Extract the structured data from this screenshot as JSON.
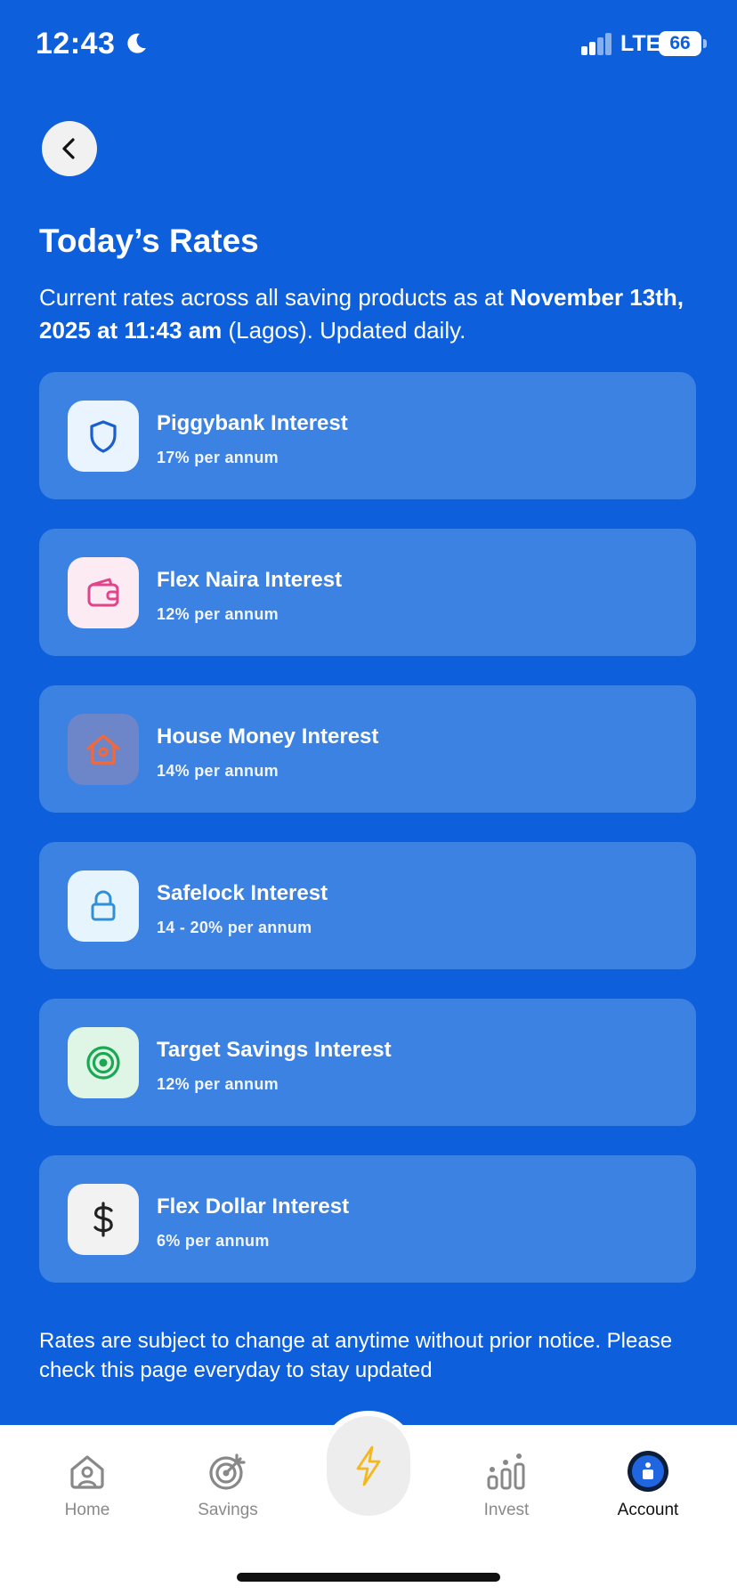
{
  "status_bar": {
    "time": "12:43",
    "network": "LTE",
    "battery": "66"
  },
  "header": {
    "title": "Today’s Rates",
    "subtitle_prefix": "Current rates across all saving products as at ",
    "subtitle_date": "November 13th, 2025 at 11:43 am",
    "subtitle_suffix": " (Lagos). Updated daily."
  },
  "rates": [
    {
      "name": "Piggybank Interest",
      "value": "17% per annum",
      "icon": "shield-icon",
      "icon_bg": "#eaf4ff",
      "icon_color": "#1a5fd0"
    },
    {
      "name": "Flex Naira Interest",
      "value": "12% per annum",
      "icon": "wallet-icon",
      "icon_bg": "#fdebf4",
      "icon_color": "#e0448a"
    },
    {
      "name": "House Money Interest",
      "value": "14% per annum",
      "icon": "house-icon",
      "icon_bg": "#6c86c9",
      "icon_color": "#f2683a"
    },
    {
      "name": "Safelock Interest",
      "value": "14 - 20% per annum",
      "icon": "lock-icon",
      "icon_bg": "#e6f4fd",
      "icon_color": "#2f8fd8"
    },
    {
      "name": "Target Savings Interest",
      "value": "12% per annum",
      "icon": "target-icon",
      "icon_bg": "#dff5e6",
      "icon_color": "#1aa853"
    },
    {
      "name": "Flex Dollar Interest",
      "value": "6% per annum",
      "icon": "dollar-icon",
      "icon_bg": "#f2f2f2",
      "icon_color": "#222222"
    }
  ],
  "footnote": "Rates are subject to change at anytime without prior notice. Please check this page everyday to stay updated",
  "tab_bar": {
    "tabs": [
      {
        "label": "Home",
        "icon": "home-icon"
      },
      {
        "label": "Savings",
        "icon": "savings-target-icon"
      },
      {
        "label": "",
        "icon": "lightning-icon"
      },
      {
        "label": "Invest",
        "icon": "invest-chart-icon"
      },
      {
        "label": "Account",
        "icon": "account-icon"
      }
    ],
    "active": "Account"
  },
  "colors": {
    "background": "#0d5fdc",
    "card": "#3c82e2",
    "accent": "#f5b81c"
  }
}
